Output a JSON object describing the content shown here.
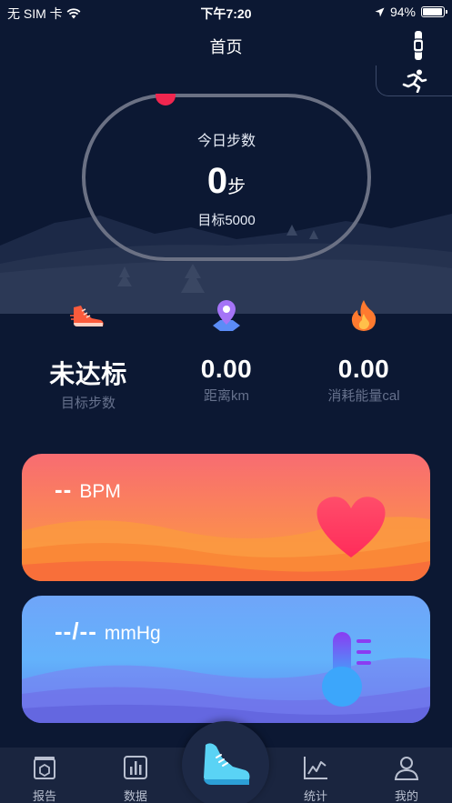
{
  "status_bar": {
    "carrier": "无 SIM 卡",
    "time": "下午7:20",
    "battery": "94%",
    "battery_level": 0.94
  },
  "nav": {
    "title": "首页"
  },
  "daily": {
    "label": "今日步数",
    "steps": "0",
    "steps_unit": "步",
    "goal": "目标5000",
    "progress": 0
  },
  "stats": [
    {
      "value": "未达标",
      "label": "目标步数",
      "icon": "running-shoe-icon"
    },
    {
      "value": "0.00",
      "label": "距离km",
      "icon": "map-pin-icon"
    },
    {
      "value": "0.00",
      "label": "消耗能量cal",
      "icon": "flame-icon"
    }
  ],
  "heart_card": {
    "value": "--",
    "unit": "BPM",
    "icon": "heart-icon"
  },
  "bp_card": {
    "value": "--/--",
    "unit": "mmHg",
    "icon": "thermometer-icon"
  },
  "tabbar": {
    "items": [
      {
        "label": "报告",
        "icon": "report-icon"
      },
      {
        "label": "数据",
        "icon": "bar-chart-icon"
      },
      {
        "label": "统计",
        "icon": "line-chart-icon"
      },
      {
        "label": "我的",
        "icon": "user-icon"
      }
    ],
    "center_icon": "shoe-icon"
  },
  "colors": {
    "background": "#0c1833",
    "accent_red": "#f0264f",
    "heart_card": "#f87860",
    "bp_card": "#68a8fa"
  }
}
